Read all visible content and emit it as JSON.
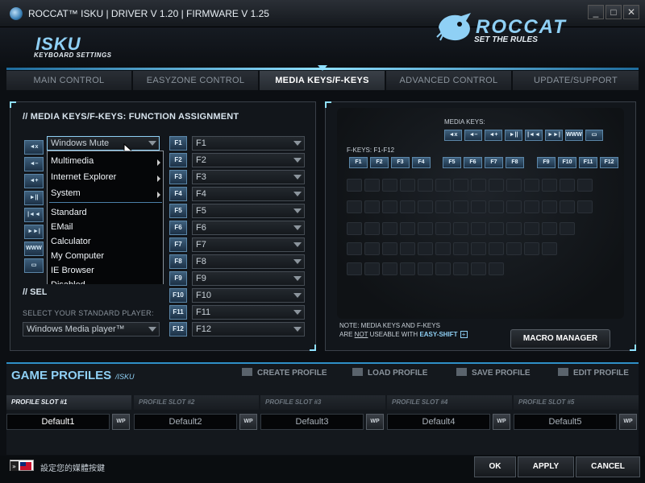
{
  "window": {
    "title": "ROCCAT™ ISKU  |  DRIVER V 1.20  |  FIRMWARE V 1.25",
    "min_glyph": "_",
    "restore_glyph": "□",
    "close_glyph": "✕"
  },
  "header": {
    "product": "ISKU",
    "product_sub": "KEYBOARD SETTINGS",
    "brand": "ROCCAT",
    "slogan": "SET THE RULES"
  },
  "tabs": [
    {
      "label": "MAIN CONTROL",
      "active": false
    },
    {
      "label": "EASYZONE CONTROL",
      "active": false
    },
    {
      "label": "MEDIA KEYS/F-KEYS",
      "active": true
    },
    {
      "label": "ADVANCED CONTROL",
      "active": false
    },
    {
      "label": "UPDATE/SUPPORT",
      "active": false
    }
  ],
  "media_panel": {
    "title": "// MEDIA KEYS/F-KEYS:  FUNCTION ASSIGNMENT",
    "media_keys": [
      "◄x",
      "◄–",
      "◄+",
      "►||",
      "|◄◄",
      "►►|",
      "WWW",
      "▭"
    ],
    "first_value": "Windows Mute",
    "popup": {
      "submenus": [
        "Multimedia",
        "Internet Explorer",
        "System"
      ],
      "items": [
        "Standard",
        "EMail",
        "Calculator",
        "My Computer",
        "IE Browser",
        "Disabled"
      ]
    },
    "standard_player": {
      "title": "// SELECT MEDIA PLAYER",
      "label": "SELECT YOUR STANDARD PLAYER:",
      "value": "Windows Media player™"
    },
    "f_keys": [
      {
        "label": "F1",
        "value": "F1"
      },
      {
        "label": "F2",
        "value": "F2"
      },
      {
        "label": "F3",
        "value": "F3"
      },
      {
        "label": "F4",
        "value": "F4"
      },
      {
        "label": "F5",
        "value": "F5"
      },
      {
        "label": "F6",
        "value": "F6"
      },
      {
        "label": "F7",
        "value": "F7"
      },
      {
        "label": "F8",
        "value": "F8"
      },
      {
        "label": "F9",
        "value": "F9"
      },
      {
        "label": "F10",
        "value": "F10"
      },
      {
        "label": "F11",
        "value": "F11"
      },
      {
        "label": "F12",
        "value": "F12"
      }
    ]
  },
  "keyboard_panel": {
    "media_keys_title": "MEDIA KEYS:",
    "media_key_labels": [
      "◄x",
      "◄–",
      "◄+",
      "►||",
      "|◄◄",
      "►►|",
      "WWW",
      "▭"
    ],
    "fkeys_title": "F-KEYS: F1-F12",
    "fkey_labels": [
      "F1",
      "F2",
      "F3",
      "F4",
      "F5",
      "F6",
      "F7",
      "F8",
      "F9",
      "F10",
      "F11",
      "F12"
    ],
    "note_line1": "NOTE: MEDIA KEYS AND F-KEYS",
    "note_line2_pre": "ARE ",
    "note_not": "NOT",
    "note_line2_mid": " USEABLE WITH ",
    "note_easyshift": "EASY-SHIFT",
    "macro_manager": "MACRO MANAGER"
  },
  "profiles": {
    "title": "GAME PROFILES",
    "sub": "/ISKU",
    "actions": [
      "CREATE PROFILE",
      "LOAD PROFILE",
      "SAVE PROFILE",
      "EDIT PROFILE"
    ],
    "slots": [
      {
        "header": "PROFILE SLOT #1",
        "name": "Default1",
        "wp": "WP",
        "active": true
      },
      {
        "header": "PROFILE SLOT #2",
        "name": "Default2",
        "wp": "WP",
        "active": false
      },
      {
        "header": "PROFILE SLOT #3",
        "name": "Default3",
        "wp": "WP",
        "active": false
      },
      {
        "header": "PROFILE SLOT #4",
        "name": "Default4",
        "wp": "WP",
        "active": false
      },
      {
        "header": "PROFILE SLOT #5",
        "name": "Default5",
        "wp": "WP",
        "active": false
      }
    ]
  },
  "footer": {
    "lang_text": "設定您的媒體按鍵",
    "ok": "OK",
    "apply": "APPLY",
    "cancel": "CANCEL"
  },
  "colors": {
    "accent": "#8fe0ff",
    "accent_dark": "#1c3146",
    "background": "#0c0f13"
  }
}
